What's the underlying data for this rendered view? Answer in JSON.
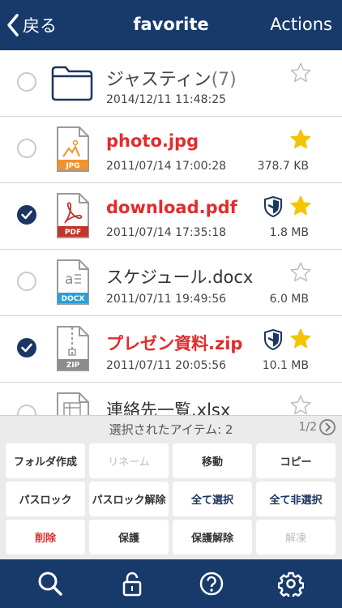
{
  "nav": {
    "back_label": "戻る",
    "title": "favorite",
    "actions_label": "Actions"
  },
  "files": [
    {
      "name": "ジャスティン",
      "count": "(7)",
      "date": "2014/12/11 11:48:25",
      "size": "",
      "type": "folder",
      "selected": false,
      "favorite": false,
      "protected": false,
      "highlight": false
    },
    {
      "name": "photo.jpg",
      "count": "",
      "date": "2011/07/14 17:00:28",
      "size": "378.7 KB",
      "type": "JPG",
      "selected": false,
      "favorite": true,
      "protected": false,
      "highlight": true
    },
    {
      "name": "download.pdf",
      "count": "",
      "date": "2011/07/14 17:35:18",
      "size": "1.8 MB",
      "type": "PDF",
      "selected": true,
      "favorite": true,
      "protected": true,
      "highlight": true
    },
    {
      "name": "スケジュール.docx",
      "count": "",
      "date": "2011/07/11 19:49:56",
      "size": "6.0 MB",
      "type": "DOCX",
      "selected": false,
      "favorite": false,
      "protected": false,
      "highlight": false
    },
    {
      "name": "プレゼン資料.zip",
      "count": "",
      "date": "2011/07/11 20:05:56",
      "size": "10.1 MB",
      "type": "ZIP",
      "selected": true,
      "favorite": true,
      "protected": true,
      "highlight": true
    },
    {
      "name": "連絡先一覧.xlsx",
      "count": "",
      "date": "",
      "size": "",
      "type": "XLSX",
      "selected": false,
      "favorite": false,
      "protected": false,
      "highlight": false
    }
  ],
  "selection": {
    "text": "選択されたアイテム: 2",
    "page": "1/2"
  },
  "actions": [
    {
      "label": "フォルダ作成",
      "style": "normal"
    },
    {
      "label": "リネーム",
      "style": "dis"
    },
    {
      "label": "移動",
      "style": "normal"
    },
    {
      "label": "コピー",
      "style": "normal"
    },
    {
      "label": "パスロック",
      "style": "normal"
    },
    {
      "label": "パスロック解除",
      "style": "normal"
    },
    {
      "label": "全て選択",
      "style": "blue"
    },
    {
      "label": "全て非選択",
      "style": "blue"
    },
    {
      "label": "削除",
      "style": "red"
    },
    {
      "label": "保護",
      "style": "normal"
    },
    {
      "label": "保護解除",
      "style": "normal"
    },
    {
      "label": "解凍",
      "style": "dis"
    }
  ],
  "tabs": [
    "search-icon",
    "lock-icon",
    "help-icon",
    "settings-icon"
  ],
  "colors": {
    "navy": "#173a6b",
    "red": "#e32c2c",
    "star": "#f5c400",
    "check": "#1b3660"
  }
}
